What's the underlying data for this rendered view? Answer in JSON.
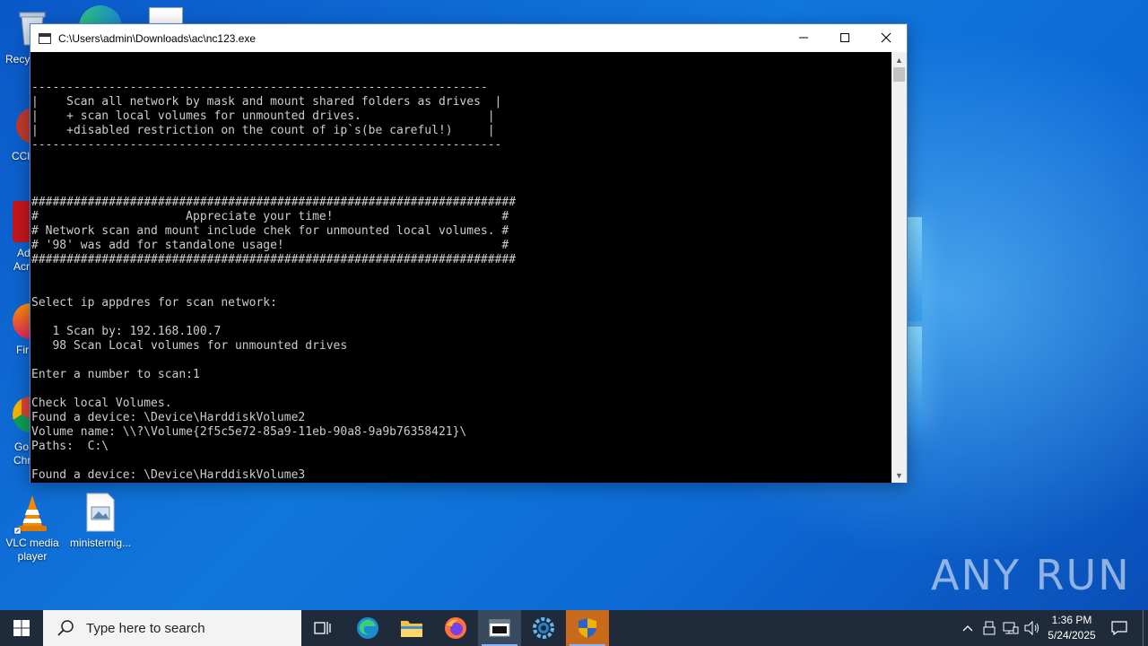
{
  "window": {
    "title": "C:\\Users\\admin\\Downloads\\ac\\nc123.exe",
    "minimize": "—",
    "maximize": "☐",
    "close": "✕"
  },
  "terminal": {
    "lines": [
      "",
      "",
      "-----------------------------------------------------------------",
      "|    Scan all network by mask and mount shared folders as drives  |",
      "|    + scan local volumes for unmounted drives.                  |",
      "|    +disabled restriction on the count of ip`s(be careful!)     |",
      "-------------------------------------------------------------------",
      "",
      "",
      "",
      "#####################################################################",
      "#                     Appreciate your time!                        #",
      "# Network scan and mount include chek for unmounted local volumes. #",
      "# '98' was add for standalone usage!                               #",
      "#####################################################################",
      "",
      "",
      "Select ip appdres for scan network:",
      "",
      "   1 Scan by: 192.168.100.7",
      "   98 Scan Local volumes for unmounted drives",
      "",
      "Enter a number to scan:1",
      "",
      "Check local Volumes.",
      "Found a device: \\Device\\HarddiskVolume2",
      "Volume name: \\\\?\\Volume{2f5c5e72-85a9-11eb-90a8-9a9b76358421}\\",
      "Paths:  C:\\",
      "",
      "Found a device: \\Device\\HarddiskVolume3"
    ]
  },
  "desktop": {
    "icons": [
      {
        "label": "VLC media player"
      },
      {
        "label": "ministernig..."
      }
    ],
    "partial_labels": [
      "Recy",
      "CCl",
      "Ad",
      "Acr",
      "Fir",
      "Go",
      "Chr"
    ]
  },
  "taskbar": {
    "search_placeholder": "Type here to search",
    "time": "1:36 PM",
    "date": "5/24/2025",
    "tray_chevron": "^"
  },
  "watermark": "ANY RUN",
  "colors": {
    "taskbar": "#1f2b3a",
    "terminal_bg": "#000000",
    "terminal_fg": "#cccccc",
    "wallpaper": "#0b58c8"
  }
}
